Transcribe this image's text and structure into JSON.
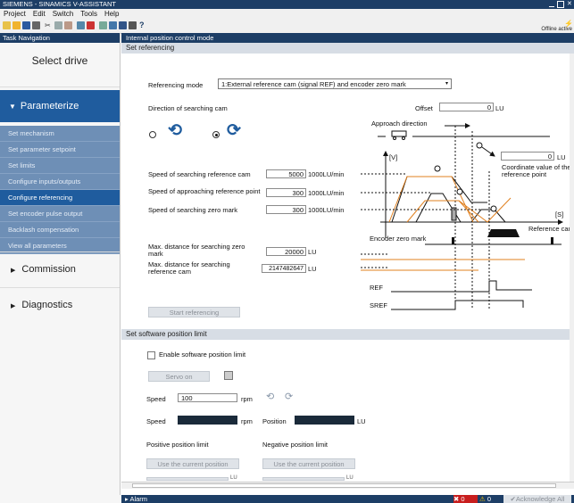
{
  "window": {
    "title": "SIEMENS - SINAMICS V-ASSISTANT"
  },
  "menu": [
    "Project",
    "Edit",
    "Switch",
    "Tools",
    "Help"
  ],
  "toolbar": {
    "offline_text": "Offline active"
  },
  "nav": {
    "header": "Task Navigation",
    "select_drive": "Select drive",
    "parameterize": "Parameterize",
    "sub_items": [
      "Set mechanism",
      "Set parameter setpoint",
      "Set limits",
      "Configure inputs/outputs",
      "Configure referencing",
      "Set encoder pulse output",
      "Backlash compensation",
      "View all parameters"
    ],
    "active_sub": "Configure referencing",
    "commission": "Commission",
    "diagnostics": "Diagnostics"
  },
  "main": {
    "header": "Internal position control mode",
    "referencing": {
      "section_title": "Set referencing",
      "mode_label": "Referencing mode",
      "mode_value": "1:External reference cam (signal REF) and encoder zero mark",
      "direction_label": "Direction of searching cam",
      "direction_selected": 2,
      "offset_label": "Offset",
      "offset_value": "0",
      "offset_unit": "LU",
      "approach_direction": "Approach direction",
      "v_axis": "[V]",
      "s_axis": "[S]",
      "coord_value": "0",
      "coord_unit": "LU",
      "coord_label": "Coordinate value of the reference point",
      "encoder_zero_mark": "Encoder zero mark",
      "reference_cam": "Reference cam",
      "ref_signal": "REF",
      "sref_signal": "SREF",
      "speed_search_cam_label": "Speed of searching reference cam",
      "speed_search_cam_value": "5000",
      "speed_search_cam_unit": "1000LU/min",
      "speed_approach_label": "Speed of approaching reference point",
      "speed_approach_value": "300",
      "speed_approach_unit": "1000LU/min",
      "speed_zero_label": "Speed of searching zero mark",
      "speed_zero_value": "300",
      "speed_zero_unit": "1000LU/min",
      "max_zero_label": "Max. distance for searching zero mark",
      "max_zero_value": "20000",
      "max_zero_unit": "LU",
      "max_cam_label": "Max. distance for searching reference cam",
      "max_cam_value": "2147482647",
      "max_cam_unit": "LU",
      "start_button": "Start referencing",
      "markers": [
        "1",
        "2",
        "3"
      ]
    },
    "software_limit": {
      "section_title": "Set software position limit",
      "enable_label": "Enable software position limit",
      "servo_on": "Servo on",
      "speed_label": "Speed",
      "speed_value": "100",
      "speed_unit": "rpm",
      "speed2_label": "Speed",
      "speed2_unit": "rpm",
      "position_label": "Position",
      "position_unit": "LU",
      "positive_label": "Positive position limit",
      "negative_label": "Negative position limit",
      "use_current": "Use the current position",
      "use_current2": "Use the current position",
      "bottom_unit1": "LU",
      "bottom_unit2": "LU"
    }
  },
  "status": {
    "alarm": "Alarm",
    "errors": "0",
    "warnings": "0",
    "acknowledge": "Acknowledge All"
  }
}
